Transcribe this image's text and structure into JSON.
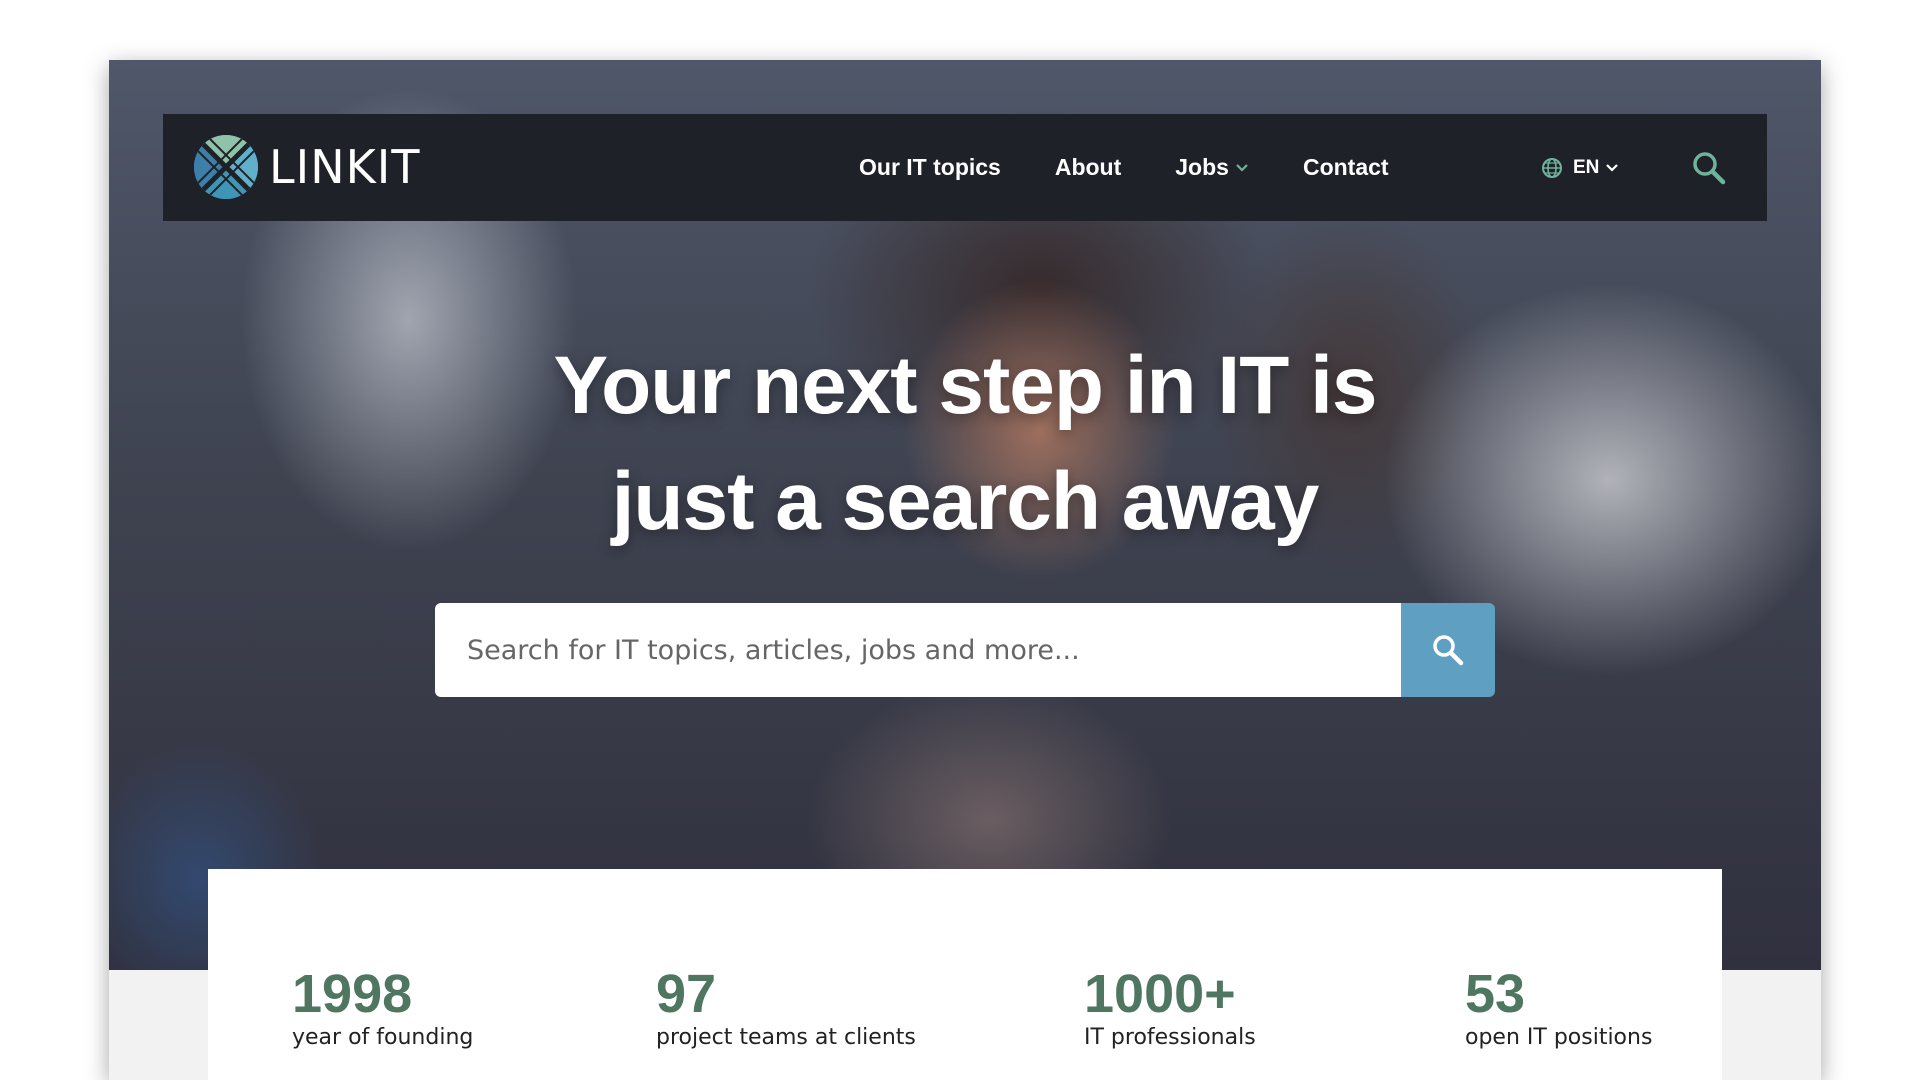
{
  "brand": {
    "name": "LINKIT"
  },
  "nav": {
    "links": [
      {
        "label": "Our IT topics",
        "has_dropdown": false
      },
      {
        "label": "About",
        "has_dropdown": false
      },
      {
        "label": "Jobs",
        "has_dropdown": true
      },
      {
        "label": "Contact",
        "has_dropdown": false
      }
    ],
    "language": "EN",
    "icons": {
      "language": "globe-icon",
      "search": "search-icon"
    }
  },
  "hero": {
    "headline_line1": "Your next step in IT is",
    "headline_line2": "just a search away",
    "search": {
      "placeholder": "Search for IT topics, articles, jobs and more..."
    }
  },
  "stats": [
    {
      "value": "1998",
      "label": "year of founding"
    },
    {
      "value": "97",
      "label": "project teams at clients"
    },
    {
      "value": "1000+",
      "label": "IT professionals"
    },
    {
      "value": "53",
      "label": "open IT positions"
    }
  ],
  "colors": {
    "nav_bg": "#1f2128",
    "accent_blue": "#5f9fc1",
    "stat_green": "#4e7661",
    "chevron_green": "#6fb39a"
  }
}
